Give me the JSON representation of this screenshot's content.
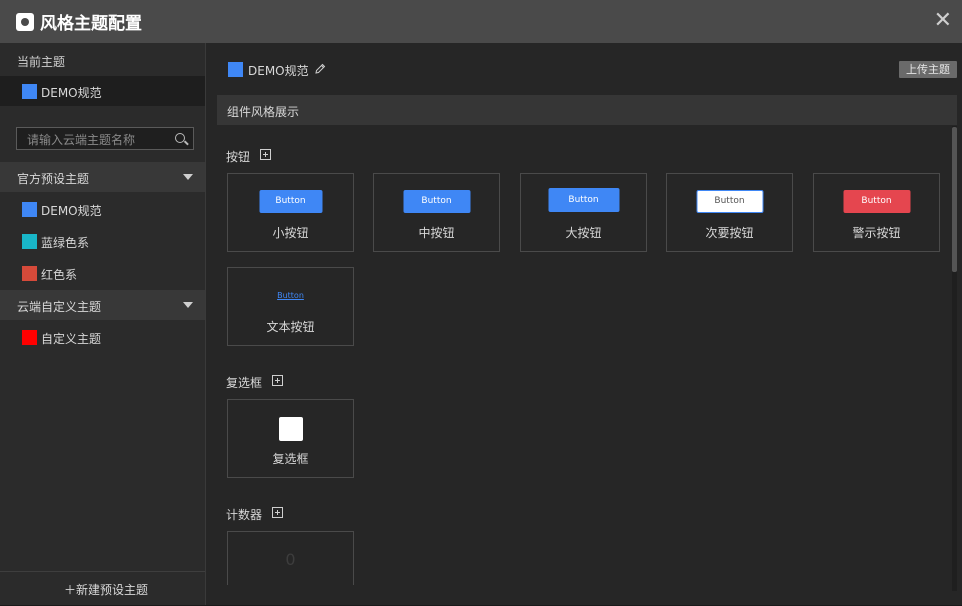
{
  "window": {
    "title": "风格主题配置"
  },
  "sidebar": {
    "current_label": "当前主题",
    "current_theme": {
      "name": "DEMO规范",
      "color": "#3f87f5"
    },
    "search_placeholder": "请输入云端主题名称",
    "preset_group": {
      "label": "官方预设主题",
      "items": [
        {
          "name": "DEMO规范",
          "color": "#3f87f5"
        },
        {
          "name": "蓝绿色系",
          "color": "#19b6c8"
        },
        {
          "name": "红色系",
          "color": "#d64a3a"
        }
      ]
    },
    "cloud_group": {
      "label": "云端自定义主题",
      "items": [
        {
          "name": "自定义主题",
          "color": "#ff0000"
        }
      ]
    },
    "new_preset_label": "＋新建预设主题"
  },
  "main": {
    "theme_name": "DEMO规范",
    "upload_label": "上传主题",
    "section_title": "组件风格展示",
    "buttons_section": {
      "label": "按钮",
      "cards": [
        {
          "demo": "Button",
          "caption": "小按钮"
        },
        {
          "demo": "Button",
          "caption": "中按钮"
        },
        {
          "demo": "Button",
          "caption": "大按钮"
        },
        {
          "demo": "Button",
          "caption": "次要按钮"
        },
        {
          "demo": "Button",
          "caption": "警示按钮"
        },
        {
          "demo": "Button",
          "caption": "文本按钮"
        }
      ]
    },
    "checkbox_section": {
      "label": "复选框",
      "card_caption": "复选框"
    },
    "counter_section": {
      "label": "计数器",
      "value": "0"
    }
  }
}
